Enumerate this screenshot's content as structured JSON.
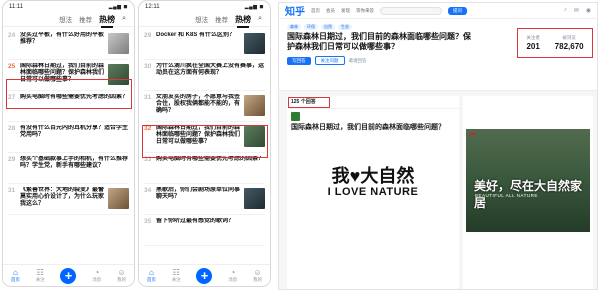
{
  "phone1": {
    "time": "11:11",
    "nav": [
      "想法",
      "推荐",
      "热榜"
    ],
    "items": [
      {
        "rank": "24",
        "title": "没买过平板，有什么好用的平板推荐？",
        "heat": "",
        "thumb": "t2"
      },
      {
        "rank": "25",
        "title": "国际森林日期过，我们目前的森林面临哪些问题？保护森林我们日常可以做哪些事？",
        "heat": "",
        "thumb": "t1"
      },
      {
        "rank": "26",
        "title": "",
        "heat": "",
        "thumb": ""
      },
      {
        "rank": "27",
        "title": "购买电脑时有哪些需要优先考虑的因素？",
        "heat": "",
        "thumb": ""
      },
      {
        "rank": "28",
        "title": "有没有什么百元内的耳机分享？适合学生党用吗？",
        "heat": "",
        "thumb": ""
      },
      {
        "rank": "29",
        "title": "想买个基础款事上手的相机，有什么推荐吗？学生党，新手有哪些建议？",
        "heat": "",
        "thumb": ""
      },
      {
        "rank": "30",
        "title": "",
        "heat": "",
        "thumb": ""
      },
      {
        "rank": "31",
        "title": "《繁善世界：大地的裂变》最警莫实用心价设计了，为什么玩家我这么？",
        "heat": "",
        "thumb": "t3"
      },
      {
        "rank": "32",
        "title": "",
        "heat": "",
        "thumb": ""
      }
    ],
    "tabs": [
      "首页",
      "关注",
      "",
      "消息",
      "我的"
    ]
  },
  "phone2": {
    "time": "12:11",
    "nav": [
      "想法",
      "推荐",
      "热榜"
    ],
    "items": [
      {
        "rank": "29",
        "title": "Docker 和 K8S 有什么区别？",
        "heat": "",
        "thumb": "t4"
      },
      {
        "rank": "30",
        "title": "为什么滴川疯在全国大赛上没有赛事，运动员在这方面有何表现？",
        "heat": "",
        "thumb": ""
      },
      {
        "rank": "31",
        "title": "女朋友买的房子，不愿意与我签合住，股权我俩都能不能的，有确吗？",
        "heat": "",
        "thumb": "t3"
      },
      {
        "rank": "32",
        "title": "国际森林日期过，我们目前的森林面临哪些问题？保护森林我们日常可以做哪些事？",
        "heat": "",
        "thumb": "t1"
      },
      {
        "rank": "33",
        "title": "购买电脑时有哪些需要优先考虑的因素？",
        "heat": "",
        "thumb": ""
      },
      {
        "rank": "34",
        "title": "黑歌后，你们会剧场原单位同事聊天吗？",
        "heat": "",
        "thumb": "t4"
      },
      {
        "rank": "35",
        "title": "留下你听过最有感觉的歌词？",
        "heat": "",
        "thumb": ""
      }
    ],
    "tabs": [
      "首页",
      "关注",
      "",
      "消息",
      "我的"
    ]
  },
  "web": {
    "logo": "知乎",
    "nav": [
      "首页",
      "会员",
      "发现",
      "等你来答"
    ],
    "search_placeholder": "",
    "ask_label": "提问",
    "header_icons": [
      "bell-icon",
      "message-icon",
      "avatar-icon"
    ],
    "question": {
      "tags": [
        "森林",
        "环保",
        "自然",
        "生态"
      ],
      "title": "国际森林日期过，我们目前的森林面临哪些问题？保护森林我们日常可以做哪些事？",
      "desc": "",
      "answer_btn": "写回答",
      "follow_btn": "关注问题",
      "more": "邀请回答"
    },
    "stats": [
      {
        "label": "关注者",
        "value": "201"
      },
      {
        "label": "被浏览",
        "value": "782,670"
      }
    ],
    "answers": {
      "count": "125 个回答",
      "author": "",
      "author_sub": "",
      "meta": "",
      "title": "国际森林日期过，我们目前的森林面临哪些问题？",
      "body": "",
      "promo_big": "我♥大自然",
      "promo_eng": "I LOVE NATURE",
      "foot": ""
    },
    "side": {
      "text": "",
      "badge": "",
      "beauty": "美好，尽在大自然家居",
      "sub": "BEAUTIFUL ALL NATURE",
      "text2": ""
    }
  }
}
